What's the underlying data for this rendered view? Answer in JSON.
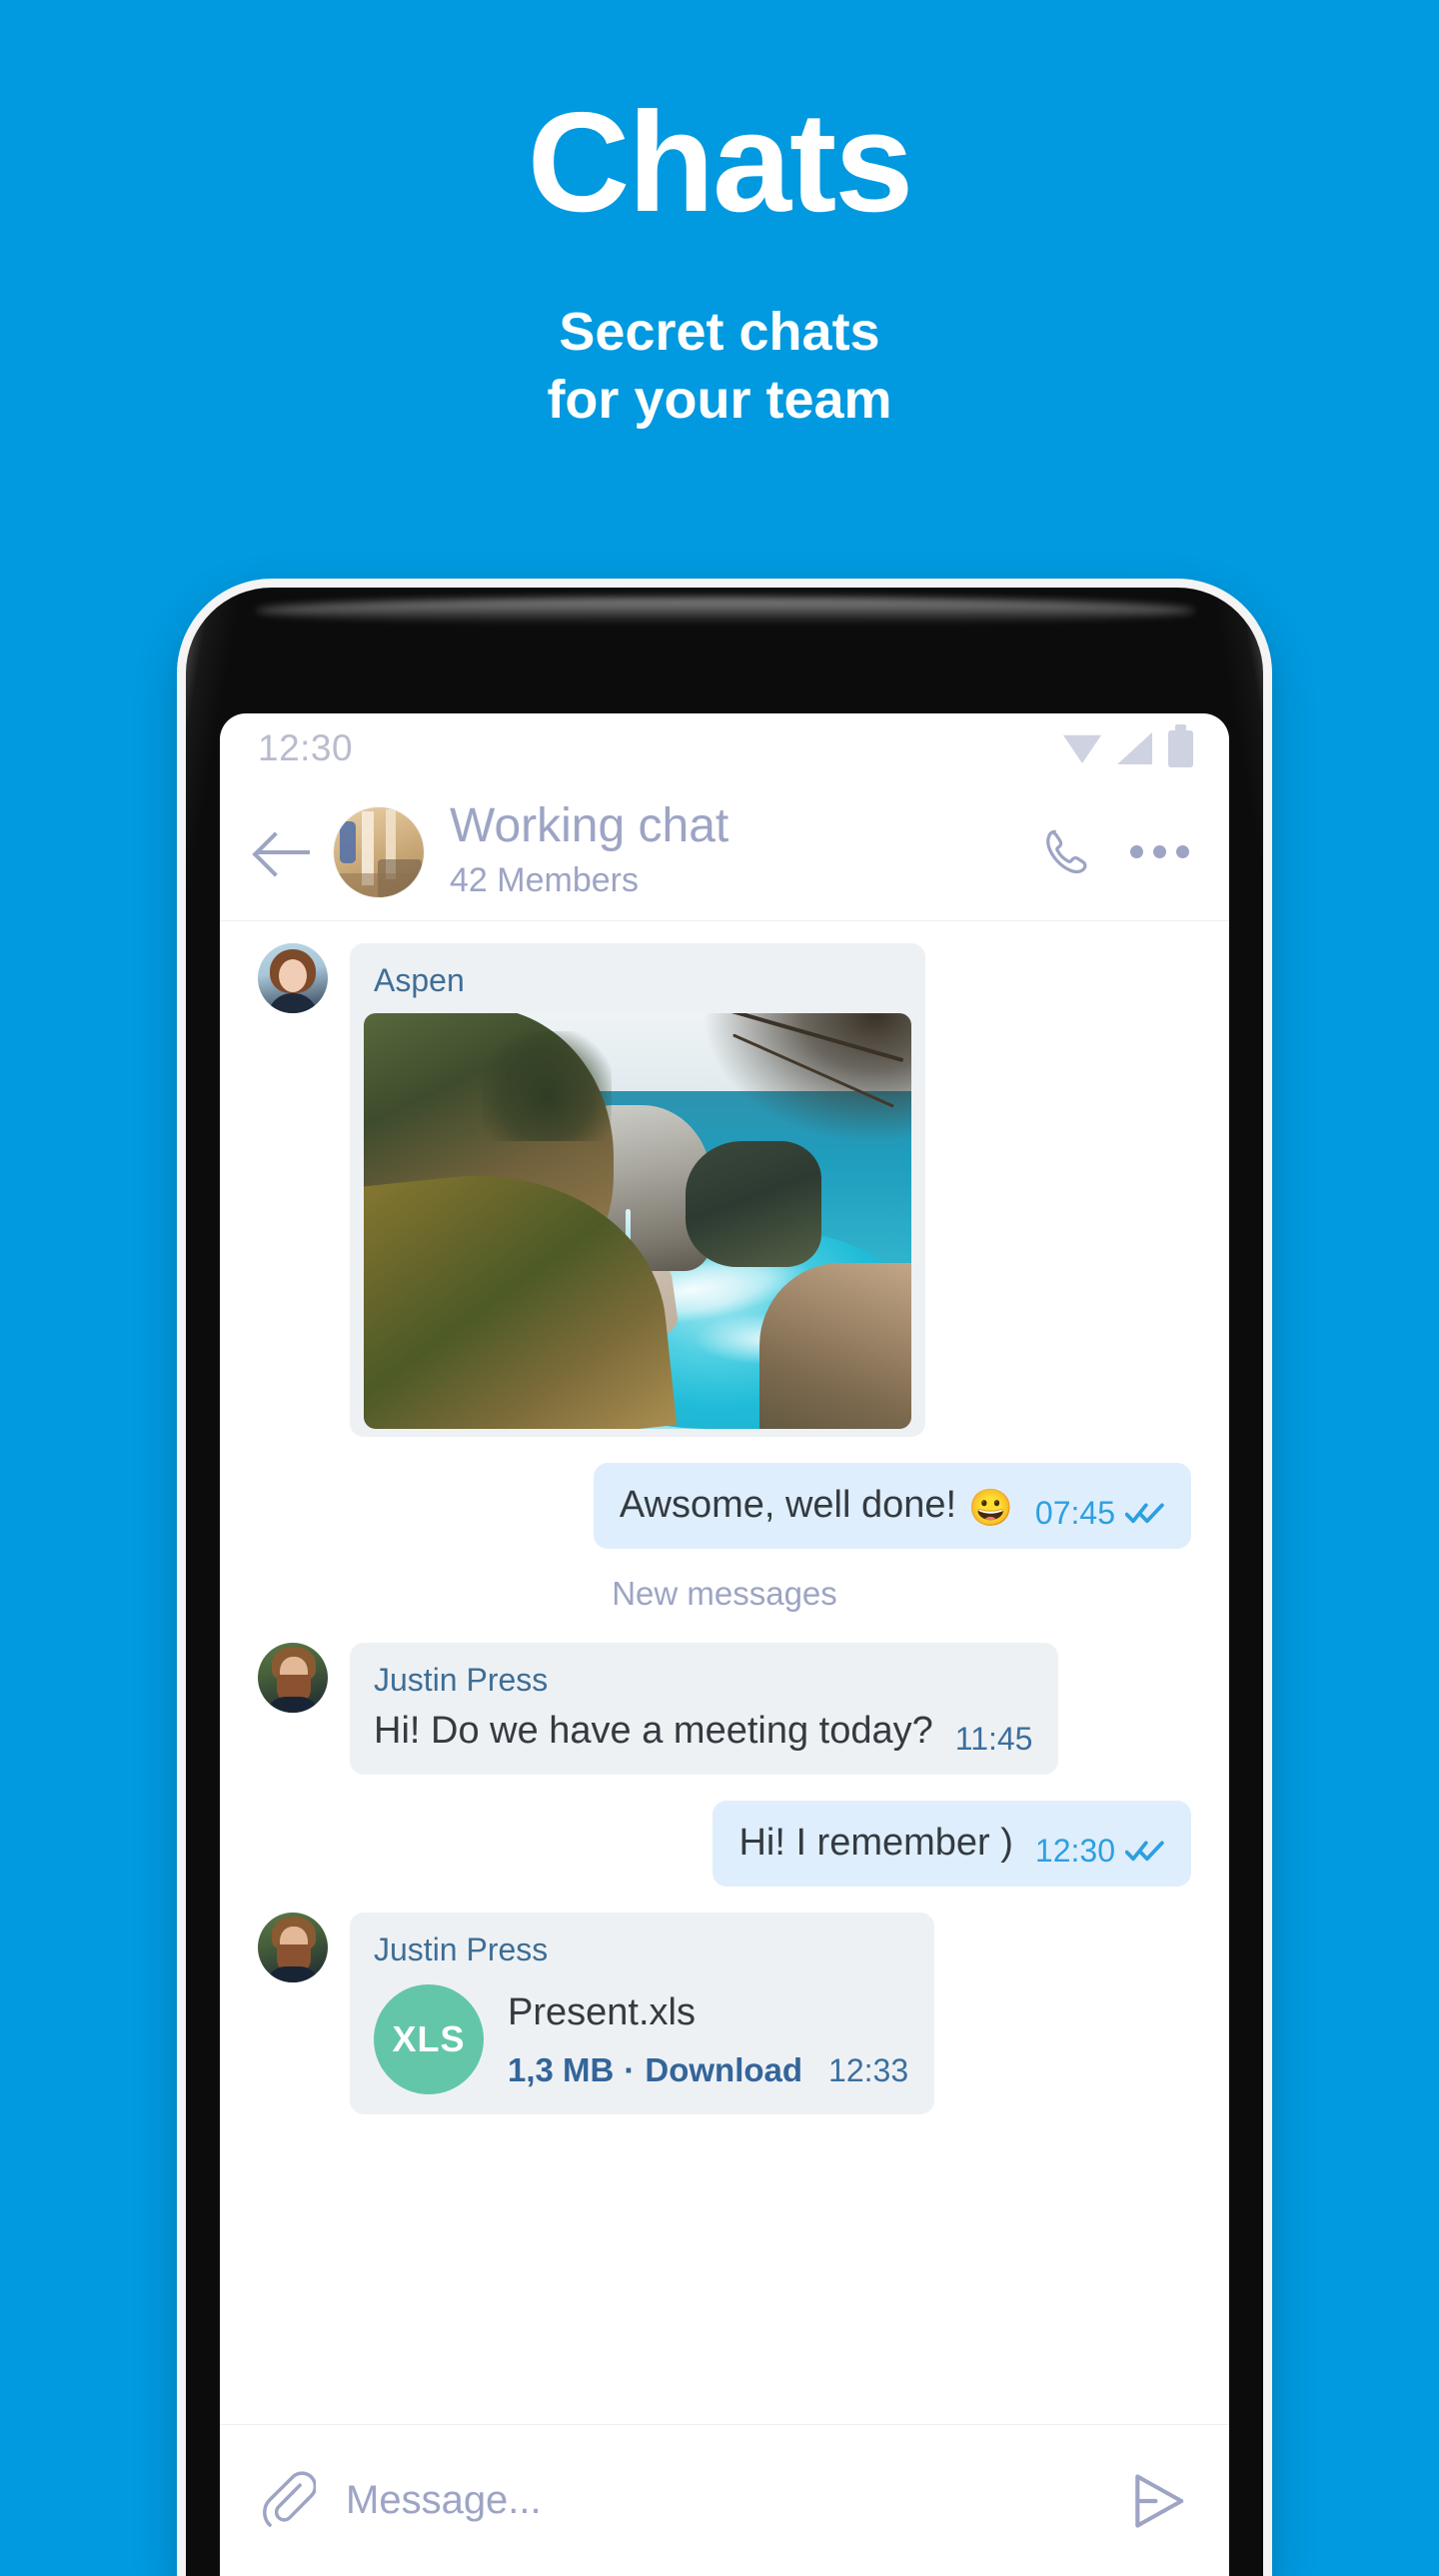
{
  "promo": {
    "title": "Chats",
    "subtitle_line1": "Secret chats",
    "subtitle_line2": "for your team",
    "background_color": "#0199DF",
    "text_color": "#FFFFFF"
  },
  "status_bar": {
    "time": "12:30",
    "icons": [
      "wifi-icon",
      "signal-icon",
      "battery-icon"
    ],
    "icon_color": "#CFD2E0"
  },
  "chat_header": {
    "back_label": "Back",
    "title": "Working chat",
    "subtitle": "42 Members",
    "avatar_label": "Working chat group photo",
    "call_label": "Call",
    "more_label": "More options",
    "text_color": "#9DA4C4"
  },
  "conversation": {
    "divider_label": "New messages",
    "messages": [
      {
        "id": "m1",
        "direction": "in",
        "sender": "Aspen",
        "type": "photo",
        "photo_alt": "Coastal cove with turquoise water and cliffs"
      },
      {
        "id": "m2",
        "direction": "out",
        "type": "text",
        "text": "Awsome, well done!",
        "emoji": "😀",
        "time": "07:45",
        "status": "read"
      },
      {
        "id": "m3",
        "direction": "in",
        "sender": "Justin Press",
        "type": "text",
        "text": "Hi! Do we have a meeting today?",
        "time": "11:45"
      },
      {
        "id": "m4",
        "direction": "out",
        "type": "text",
        "text": "Hi! I remember )",
        "time": "12:30",
        "status": "read"
      },
      {
        "id": "m5",
        "direction": "in",
        "sender": "Justin Press",
        "type": "file",
        "file_badge": "XLS",
        "file_name": "Present.xls",
        "file_size": "1,3 MB",
        "file_action": "Download",
        "file_separator": "·",
        "time": "12:33"
      }
    ],
    "colors": {
      "incoming_bubble": "#EEF1F4",
      "outgoing_bubble": "#DEEEFC",
      "sender_name": "#3E6E96",
      "message_text": "#343A40",
      "time_out": "#2E9FE0",
      "time_in": "#3B6F9E",
      "file_badge": "#63C6A8",
      "link": "#33659A"
    }
  },
  "input_bar": {
    "attach_label": "Attach file",
    "placeholder": "Message...",
    "value": "",
    "send_label": "Send"
  }
}
